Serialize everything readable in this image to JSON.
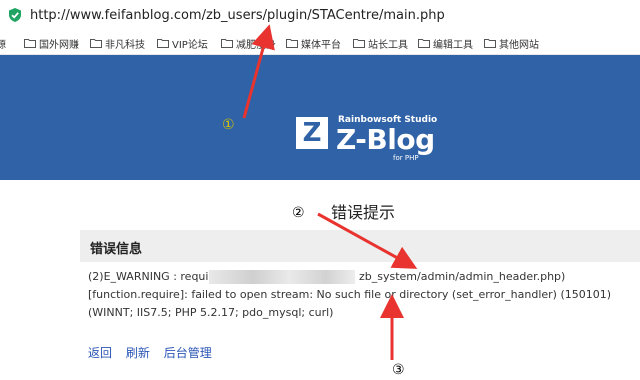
{
  "address_bar": {
    "url": "http://www.feifanblog.com/zb_users/plugin/STACentre/main.php",
    "icon": "shield-check-icon"
  },
  "bookmarks": [
    {
      "label": "资源",
      "icon": "folder-icon"
    },
    {
      "label": "国外网赚",
      "icon": "folder-icon"
    },
    {
      "label": "非凡科技",
      "icon": "folder-icon"
    },
    {
      "label": "VIP论坛",
      "icon": "folder-icon"
    },
    {
      "label": "减肥瘦身",
      "icon": "folder-icon"
    },
    {
      "label": "媒体平台",
      "icon": "folder-icon"
    },
    {
      "label": "站长工具",
      "icon": "folder-icon"
    },
    {
      "label": "编辑工具",
      "icon": "folder-icon"
    },
    {
      "label": "其他网站",
      "icon": "folder-icon"
    }
  ],
  "banner": {
    "background": "#2f62a6",
    "logo_letter": "Z",
    "studio": "Rainbowsoft Studio",
    "brand": "Z-Blog",
    "sub": "for PHP"
  },
  "page": {
    "title": "错误提示",
    "error_header": "错误信息",
    "error_line1_prefix": "(2)E_WARNING : require",
    "error_line1_suffix": "zb_system/admin/admin_header.php)",
    "error_line2": "[function.require]: failed to open stream: No such file or directory (set_error_handler) (150101)",
    "error_line3": "(WINNT; IIS7.5; PHP 5.2.17; pdo_mysql; curl)"
  },
  "links": {
    "back": "返回",
    "refresh": "刷新",
    "admin": "后台管理"
  },
  "annotations": {
    "marker1": "①",
    "marker2": "②",
    "marker3": "③",
    "arrow_color": "#e8332f",
    "marker1_color": "#d4c400"
  }
}
